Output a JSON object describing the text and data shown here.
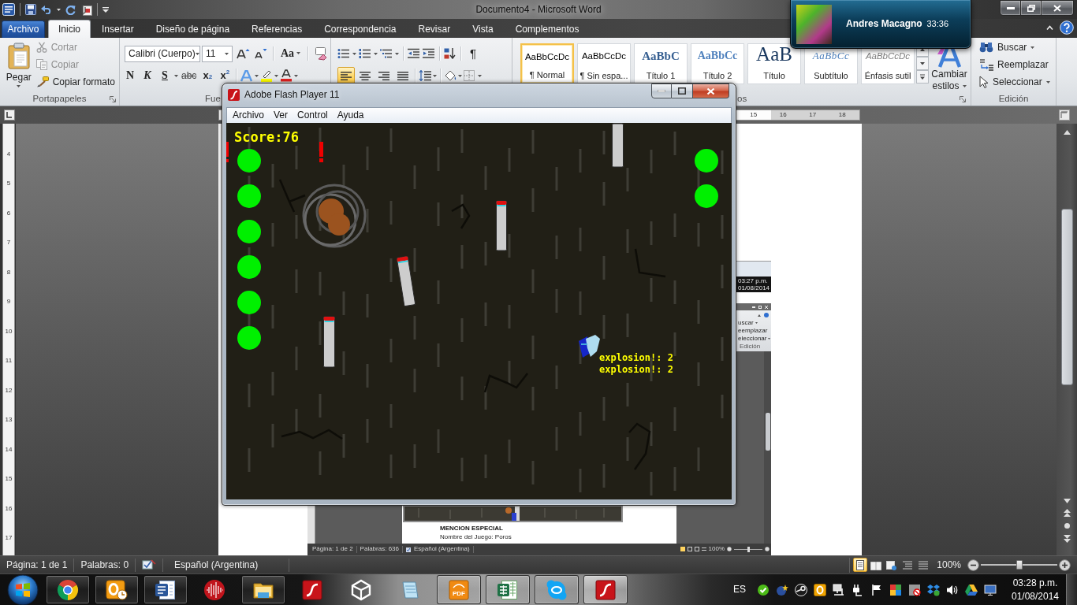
{
  "window": {
    "title": "Documento4 - Microsoft Word"
  },
  "notification": {
    "name": "Andres Macagno",
    "time": "33:36"
  },
  "ribbon_tabs": [
    {
      "label": "Archivo",
      "kind": "file",
      "selected": false
    },
    {
      "label": "Inicio",
      "kind": "tab",
      "selected": true
    },
    {
      "label": "Insertar",
      "kind": "tab",
      "selected": false
    },
    {
      "label": "Diseño de página",
      "kind": "tab",
      "selected": false
    },
    {
      "label": "Referencias",
      "kind": "tab",
      "selected": false
    },
    {
      "label": "Correspondencia",
      "kind": "tab",
      "selected": false
    },
    {
      "label": "Revisar",
      "kind": "tab",
      "selected": false
    },
    {
      "label": "Vista",
      "kind": "tab",
      "selected": false
    },
    {
      "label": "Complementos",
      "kind": "tab",
      "selected": false
    }
  ],
  "clipboard": {
    "label": "Portapapeles",
    "paste": "Pegar",
    "commands": [
      {
        "label": "Cortar",
        "kind": "cut",
        "disabled": true
      },
      {
        "label": "Copiar",
        "kind": "copy",
        "disabled": true
      },
      {
        "label": "Copiar formato",
        "kind": "format-painter",
        "disabled": false
      }
    ]
  },
  "font": {
    "label": "Fue",
    "font_name": "Calibri (Cuerpo)",
    "font_size": "11",
    "change_case": "Aa",
    "format_buttons": [
      {
        "label": "N",
        "kind": "bold"
      },
      {
        "label": "K",
        "kind": "italic"
      },
      {
        "label": "S",
        "kind": "underline"
      },
      {
        "label": "abc",
        "kind": "strike"
      },
      {
        "label": "x$_{2}$",
        "kind": "subscript"
      },
      {
        "label": "x$^{2}$",
        "kind": "superscript"
      }
    ]
  },
  "paragraph": {
    "pilcrow": "¶",
    "alignment": [
      {
        "kind": "left",
        "selected": true
      },
      {
        "kind": "center",
        "selected": false
      },
      {
        "kind": "right",
        "selected": false
      },
      {
        "kind": "justify",
        "selected": false
      }
    ]
  },
  "styles": {
    "label": "os",
    "gallery": [
      {
        "preview": "AaBbCcDc",
        "label": "¶ Normal",
        "kind": "normal",
        "selected": true
      },
      {
        "preview": "AaBbCcDc",
        "label": "¶ Sin espa...",
        "kind": "plain",
        "selected": false
      },
      {
        "preview": "AaBbC",
        "label": "Título 1",
        "kind": "heading1",
        "selected": false
      },
      {
        "preview": "AaBbCc",
        "label": "Título 2",
        "kind": "heading2",
        "selected": false
      },
      {
        "preview": "AaB",
        "label": "Título",
        "kind": "title",
        "selected": false
      },
      {
        "preview": "AaBbCc",
        "label": "Subtítulo",
        "kind": "subtitle",
        "selected": false
      },
      {
        "preview": "AaBbCcDc",
        "label": "Énfasis sutil",
        "kind": "emphasis",
        "selected": false
      }
    ],
    "change_styles": [
      "Cambiar",
      "estilos"
    ]
  },
  "editing": {
    "label": "Edición",
    "commands": [
      {
        "label": "Buscar",
        "kind": "find",
        "dropdown": true
      },
      {
        "label": "Reemplazar",
        "kind": "replace",
        "dropdown": false
      },
      {
        "label": "Seleccionar",
        "kind": "select",
        "dropdown": true
      }
    ]
  },
  "horizontal_ruler": [
    "15",
    "16",
    "17",
    "18"
  ],
  "vertical_ruler": [
    "4",
    "5",
    "6",
    "7",
    "8",
    "9",
    "10",
    "11",
    "12",
    "13",
    "14",
    "15",
    "16",
    "17"
  ],
  "flash_window": {
    "title": "Adobe Flash Player 11",
    "menu": [
      "Archivo",
      "Ver",
      "Control",
      "Ayuda"
    ],
    "game": {
      "score": "Score:76",
      "messages": [
        "explosion!: 2",
        "explosion!: 2"
      ]
    }
  },
  "embedded_screenshot": {
    "clock": [
      "03:27 p.m.",
      "01/08/2014"
    ],
    "editing": [
      {
        "label": "uscar",
        "dropdown": true
      },
      {
        "label": "eemplazar",
        "dropdown": false
      },
      {
        "label": "eleccionar",
        "dropdown": true
      }
    ],
    "editing_label": "Edición",
    "heading": "MENCION ESPECIAL",
    "text": "Nombre del Juego: Poros",
    "status": [
      "Página: 1 de 2",
      "Palabras: 636",
      "Español (Argentina)",
      "100%"
    ],
    "zoom_slider": {
      "level": 0.5
    }
  },
  "status_bar": {
    "page": "Página: 1 de 1",
    "words": "Palabras: 0",
    "language": "Español (Argentina)",
    "views": [
      {
        "kind": "print",
        "selected": true
      },
      {
        "kind": "reading",
        "selected": false
      },
      {
        "kind": "web",
        "selected": false
      },
      {
        "kind": "outline",
        "selected": false
      },
      {
        "kind": "draft",
        "selected": false
      }
    ],
    "zoom": "100%",
    "zoom_slider": {
      "level": 0.5
    }
  },
  "taskbar": {
    "apps": [
      {
        "kind": "chrome",
        "running": true,
        "active": false
      },
      {
        "kind": "outlook",
        "running": true,
        "active": false
      },
      {
        "kind": "word",
        "running": true,
        "active": false
      },
      {
        "kind": "audio",
        "running": false,
        "active": false
      },
      {
        "kind": "explorer",
        "running": true,
        "active": false
      },
      {
        "kind": "flash",
        "running": false,
        "active": false
      },
      {
        "kind": "unity",
        "running": false,
        "active": false
      },
      {
        "kind": "notepad",
        "running": false,
        "active": false
      },
      {
        "kind": "pdf",
        "running": true,
        "active": false,
        "label": "PDF"
      },
      {
        "kind": "excel",
        "running": true,
        "active": false
      },
      {
        "kind": "skype",
        "running": true,
        "active": false
      },
      {
        "kind": "flash",
        "running": true,
        "active": true
      }
    ],
    "language": "ES",
    "time": "03:28 p.m.",
    "date": "01/08/2014"
  }
}
